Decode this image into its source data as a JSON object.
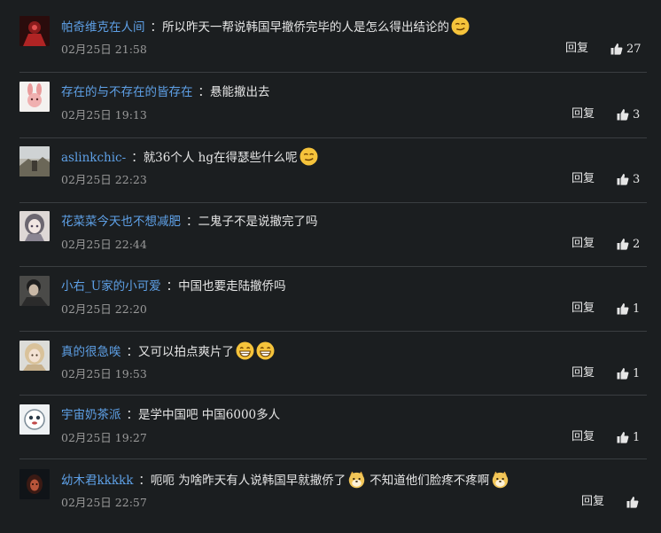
{
  "separator": "：",
  "reply_label": "回复",
  "comments": [
    {
      "user": "帕奇维克在人间",
      "text": "所以昨天一帮说韩国早撤侨完毕的人是怎么得出结论的",
      "time": "02月25日 21:58",
      "likes": "27",
      "avatar_icon": "red-warrior-avatar",
      "emoji": [
        "smirk-emoji"
      ]
    },
    {
      "user": "存在的与不存在的皆存在",
      "text": "悬能撤出去",
      "time": "02月25日 19:13",
      "likes": "3",
      "avatar_icon": "pink-bunny-avatar",
      "emoji": []
    },
    {
      "user": "aslinkchic-",
      "text": "就36个人 hg在得瑟些什么呢",
      "time": "02月25日 22:23",
      "likes": "3",
      "avatar_icon": "landscape-avatar",
      "emoji": [
        "smirk-emoji"
      ]
    },
    {
      "user": "花菜菜今天也不想减肥",
      "text": "二鬼子不是说撤完了吗",
      "time": "02月25日 22:44",
      "likes": "2",
      "avatar_icon": "anime-girl-avatar",
      "emoji": []
    },
    {
      "user": "小右_U家的小可爱",
      "text": "中国也要走陆撤侨吗",
      "time": "02月25日 22:20",
      "likes": "1",
      "avatar_icon": "dark-portrait-avatar",
      "emoji": []
    },
    {
      "user": "真的很急唉",
      "text": "又可以拍点爽片了",
      "time": "02月25日 19:53",
      "likes": "1",
      "avatar_icon": "blonde-girl-avatar",
      "emoji": [
        "grin-emoji",
        "grin-emoji"
      ]
    },
    {
      "user": "宇宙奶茶派",
      "text": "是学中国吧 中国6000多人",
      "time": "02月25日 19:27",
      "likes": "1",
      "avatar_icon": "white-cartoon-avatar",
      "emoji": []
    },
    {
      "user": "幼木君kkkkk",
      "text": "呃呃 为啥昨天有人说韩国早就撤侨了",
      "text2": "不知道他们脸疼不疼啊",
      "time": "02月25日 22:57",
      "likes": "",
      "avatar_icon": "dark-red-avatar",
      "emoji": [
        "doge-emoji"
      ],
      "emoji2": [
        "doge-emoji"
      ]
    }
  ]
}
